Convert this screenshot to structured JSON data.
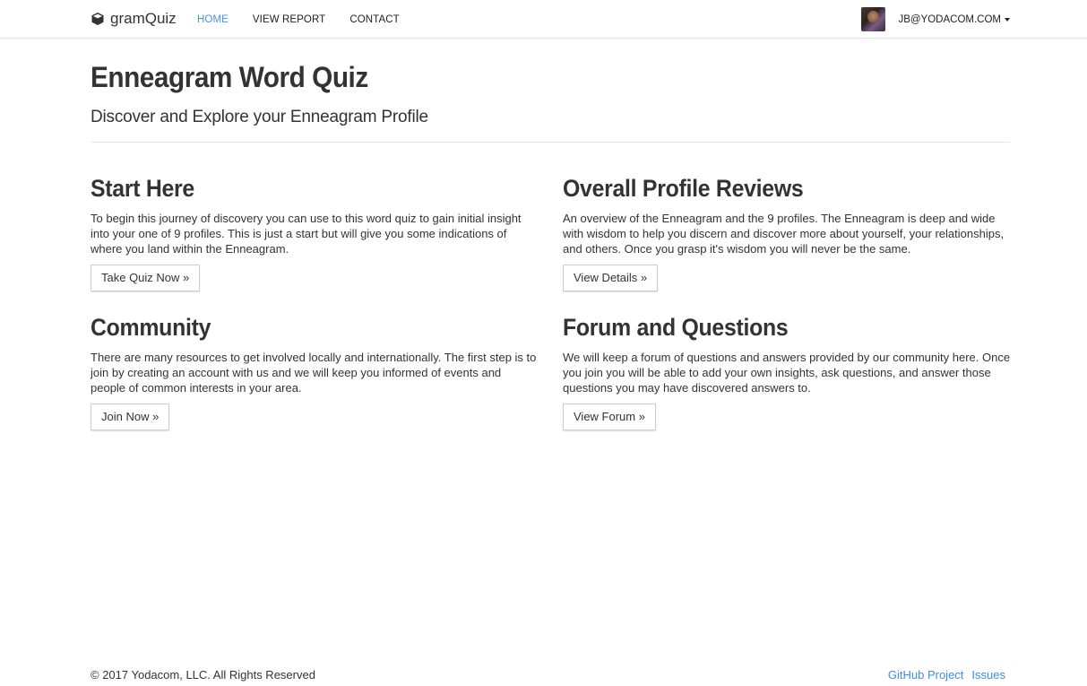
{
  "navbar": {
    "brand": "gramQuiz",
    "brand_icon": "cube-icon",
    "links": [
      {
        "label": "HOME",
        "active": true
      },
      {
        "label": "VIEW REPORT",
        "active": false
      },
      {
        "label": "CONTACT",
        "active": false
      }
    ],
    "user_email": "JB@YODACOM.COM",
    "accent_color": "#4a90e2"
  },
  "hero": {
    "title": "Enneagram Word Quiz",
    "subtitle": "Discover and Explore your Enneagram Profile"
  },
  "cards": [
    {
      "heading": "Start Here",
      "text": "To begin this journey of discovery you can use to this word quiz to gain initial insight into your one of 9 profiles. This is just a start but will give you some indications of where you land within the Enneagram.",
      "button": "Take Quiz Now »"
    },
    {
      "heading": "Overall Profile Reviews",
      "text": "An overview of the Enneagram and the 9 profiles. The Enneagram is deep and wide with wisdom to help you discern and discover more about yourself, your relationships, and others. Once you grasp it's wisdom you will never be the same.",
      "button": "View Details »"
    },
    {
      "heading": "Community",
      "text": "There are many resources to get involved locally and internationally. The first step is to join by creating an account with us and we will keep you informed of events and people of common interests in your area.",
      "button": "Join Now »"
    },
    {
      "heading": "Forum and Questions",
      "text": "We will keep a forum of questions and answers provided by our community here. Once you join you will be able to add your own insights, ask questions, and answer those questions you may have discovered answers to.",
      "button": "View Forum »"
    }
  ],
  "footer": {
    "copyright": "© 2017 Yodacom, LLC. All Rights Reserved",
    "links": [
      "GitHub Project",
      "Issues"
    ],
    "link_color": "#3a8ee6"
  }
}
